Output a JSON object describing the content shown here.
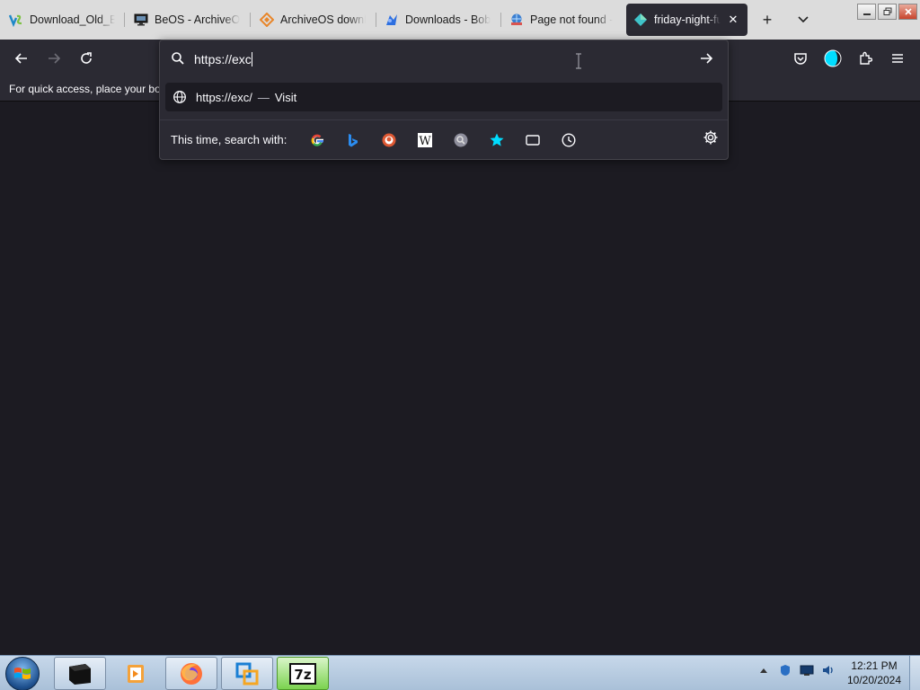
{
  "tabs": [
    {
      "title": "Download_Old_B",
      "icon": "vs-logo-icon"
    },
    {
      "title": "BeOS - ArchiveOS",
      "icon": "monitor-icon"
    },
    {
      "title": "ArchiveOS downl",
      "icon": "archiveos-diamond-icon"
    },
    {
      "title": "Downloads - Bob",
      "icon": "bob-logo-icon"
    },
    {
      "title": "Page not found -",
      "icon": "globe-book-icon"
    },
    {
      "title": "friday-night-fu",
      "icon": "replit-diamond-icon",
      "active": true
    }
  ],
  "tab_close_glyph": "✕",
  "new_tab_glyph": "+",
  "list_tabs_glyph": "⌄",
  "bookmarks_bar_text": "For quick access, place your boo",
  "urlbar": {
    "value": "https://exc",
    "suggestion_url": "https://exc/",
    "suggestion_dash": "—",
    "suggestion_action": "Visit",
    "search_with_label": "This time, search with:",
    "engines": [
      "google-icon",
      "bing-icon",
      "duckduckgo-icon",
      "wikipedia-icon",
      "search-engine-icon",
      "bookmarks-star-icon",
      "tabs-icon",
      "history-icon"
    ]
  },
  "clock": {
    "time": "12:21 PM",
    "date": "10/20/2024"
  },
  "colors": {
    "accent": "#00ddff",
    "chrome_dark": "#2b2a33",
    "content_bg": "#1c1b22"
  }
}
